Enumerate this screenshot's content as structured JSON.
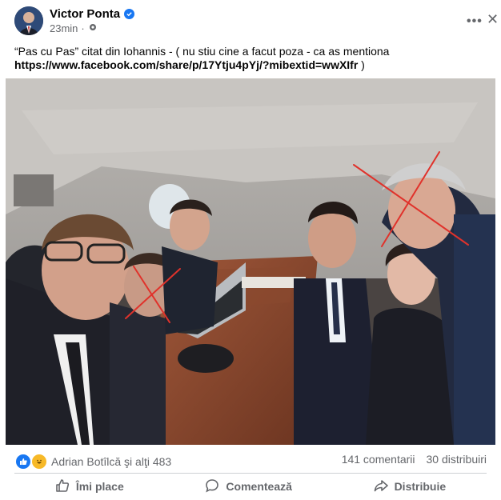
{
  "post": {
    "author": "Victor Ponta",
    "time": "23min",
    "text_line1": "“Pas cu Pas” citat din Iohannis - ( nu stiu cine a facut poza -  ca as mentiona",
    "text_line2_link": "https://www.facebook.com/share/p/17Ytju4pYj/?mibextid=wwXIfr",
    "text_line2_tail": " )"
  },
  "icons": {
    "verified": "verified-badge-icon",
    "privacy": "gear-icon",
    "more": "more-options-icon",
    "like": "thumbs-up-icon",
    "comment": "comment-bubble-icon",
    "share": "share-arrow-icon"
  },
  "engagement": {
    "reactions_text": "Adrian Botîlcă şi alţi 483",
    "comments": "141 comentarii",
    "shares": "30 distribuiri"
  },
  "actions": {
    "like": "Îmi place",
    "comment": "Comentează",
    "share": "Distribuie"
  },
  "colors": {
    "accent": "#1877f2",
    "muted": "#65676b",
    "cross": "#e0322b"
  }
}
